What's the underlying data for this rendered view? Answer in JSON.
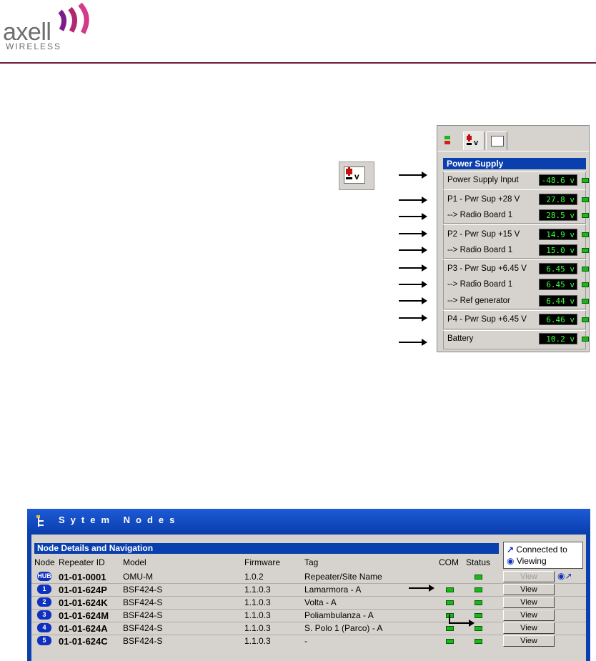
{
  "brand": {
    "name": "axell",
    "subtitle": "WIRELESS",
    "accent": "#6b1d3a",
    "logo_color": "#7a1e8e"
  },
  "power_supply": {
    "title": "Power Supply",
    "tabs": [
      "status-tab-icon",
      "power-supply-tab-icon",
      "meter-tab-icon"
    ],
    "rows": [
      {
        "label": "Power Supply Input",
        "value": "-48.6 v"
      },
      {
        "label": "P1 - Pwr Sup +28 V",
        "value": "27.8 v"
      },
      {
        "label": "--> Radio Board 1",
        "value": "28.5 v"
      },
      {
        "label": "P2 - Pwr Sup +15 V",
        "value": "14.9 v"
      },
      {
        "label": "--> Radio Board 1",
        "value": "15.0 v"
      },
      {
        "label": "P3 - Pwr Sup +6.45 V",
        "value": "6.45 v"
      },
      {
        "label": "--> Radio Board 1",
        "value": "6.45 v"
      },
      {
        "label": "--> Ref generator",
        "value": "6.44 v"
      },
      {
        "label": "P4 - Pwr Sup +6.45 V",
        "value": "6.46 v"
      },
      {
        "label": "Battery",
        "value": "10.2 v"
      }
    ]
  },
  "system_nodes": {
    "title": "Sytem Nodes",
    "section_title": "Node Details and Navigation",
    "legend": {
      "connected": "Connected to",
      "viewing": "Viewing"
    },
    "columns": [
      "Node",
      "Repeater ID",
      "Model",
      "Firmware",
      "Tag",
      "COM",
      "Status"
    ],
    "rows": [
      {
        "node": "HUB",
        "id": "01-01-0001",
        "model": "OMU-M",
        "firmware": "1.0.2",
        "tag": "Repeater/Site Name",
        "com": false,
        "view": "View",
        "view_enabled": false
      },
      {
        "node": "1",
        "id": "01-01-624P",
        "model": "BSF424-S",
        "firmware": "1.1.0.3",
        "tag": "Lamarmora - A",
        "com": true,
        "view": "View",
        "view_enabled": true
      },
      {
        "node": "2",
        "id": "01-01-624K",
        "model": "BSF424-S",
        "firmware": "1.1.0.3",
        "tag": "Volta - A",
        "com": true,
        "view": "View",
        "view_enabled": true
      },
      {
        "node": "3",
        "id": "01-01-624M",
        "model": "BSF424-S",
        "firmware": "1.1.0.3",
        "tag": "Poliambulanza - A",
        "com": true,
        "view": "View",
        "view_enabled": true
      },
      {
        "node": "4",
        "id": "01-01-624A",
        "model": "BSF424-S",
        "firmware": "1.1.0.3",
        "tag": "S. Polo 1 (Parco) - A",
        "com": true,
        "view": "View",
        "view_enabled": true
      },
      {
        "node": "5",
        "id": "01-01-624C",
        "model": "BSF424-S",
        "firmware": "1.1.0.3",
        "tag": "-",
        "com": true,
        "view": "View",
        "view_enabled": true
      }
    ]
  }
}
